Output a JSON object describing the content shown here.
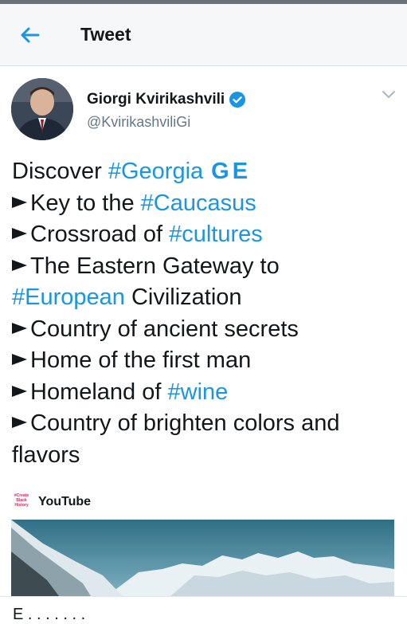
{
  "header": {
    "title": "Tweet"
  },
  "author": {
    "name": "Giorgi Kvirikashvili",
    "handle": "@KvirikashviliGi"
  },
  "tweet": {
    "line1_text": "Discover ",
    "line1_tag": "#Georgia",
    "line1_flag": "GE",
    "line2_text": "Key to the ",
    "line2_tag": "#Caucasus",
    "line3_text": "Crossroad of ",
    "line3_tag": "#cultures",
    "line4_text": "The Eastern Gateway to",
    "line5_tag": "#European",
    "line5_text": " Civilization",
    "line6_text": "Country of ancient secrets",
    "line7_text": "Home of the first man",
    "line8_text": "Homeland of ",
    "line8_tag": "#wine",
    "line9_text": "Country of brighten colors and",
    "line10_text": "flavors"
  },
  "card": {
    "source": "YouTube",
    "logo_text": "#Create Black History"
  },
  "footer": {
    "partial_text": "E . . . . . . ."
  },
  "colors": {
    "link": "#1b95e0",
    "text": "#14171a",
    "muted": "#657786"
  }
}
